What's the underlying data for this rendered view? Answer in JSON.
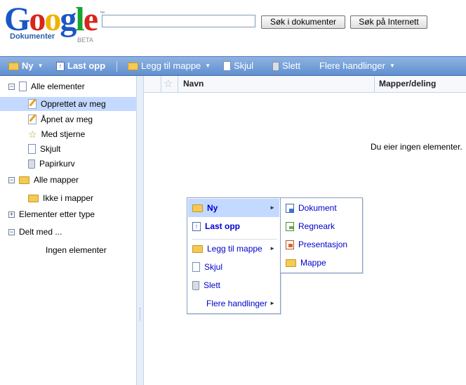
{
  "logo": {
    "wordmark": "Google",
    "product": "Dokumenter",
    "beta": "BETA",
    "tm": "™"
  },
  "search": {
    "value": "",
    "search_docs_label": "Søk i dokumenter",
    "search_web_label": "Søk på Internett"
  },
  "toolbar": {
    "new_label": "Ny",
    "upload_label": "Last opp",
    "add_to_folder_label": "Legg til mappe",
    "hide_label": "Skjul",
    "delete_label": "Slett",
    "more_actions_label": "Flere handlinger"
  },
  "sidebar": {
    "all_items": "Alle elementer",
    "created_by_me": "Opprettet av meg",
    "opened_by_me": "Åpnet av meg",
    "starred": "Med stjerne",
    "hidden": "Skjult",
    "trash": "Papirkurv",
    "all_folders": "Alle mapper",
    "not_in_folders": "Ikke i mapper",
    "items_by_type": "Elementer etter type",
    "shared_with": "Delt med ...",
    "no_items": "Ingen elementer",
    "expand_minus": "−",
    "expand_plus": "+"
  },
  "grid": {
    "col_name": "Navn",
    "col_folders": "Mapper/deling",
    "empty_message": "Du eier ingen elementer."
  },
  "context_menu": {
    "new": "Ny",
    "upload": "Last opp",
    "add_to_folder": "Legg til mappe",
    "hide": "Skjul",
    "delete": "Slett",
    "more_actions": "Flere handlinger"
  },
  "new_submenu": {
    "document": "Dokument",
    "spreadsheet": "Regneark",
    "presentation": "Presentasjon",
    "folder": "Mappe"
  },
  "glyphs": {
    "caret": "▼",
    "arrow": "►",
    "star": "☆",
    "star_filled": "★",
    "upload_arrow": "↑"
  },
  "colors": {
    "toolbar": "#6b97d6",
    "selection": "#c3d9ff",
    "link": "#0000cc"
  },
  "icons": [
    "folder-icon",
    "upload-icon",
    "document-icon",
    "trash-icon",
    "pencil-icon",
    "star-icon",
    "spreadsheet-icon",
    "presentation-icon"
  ]
}
